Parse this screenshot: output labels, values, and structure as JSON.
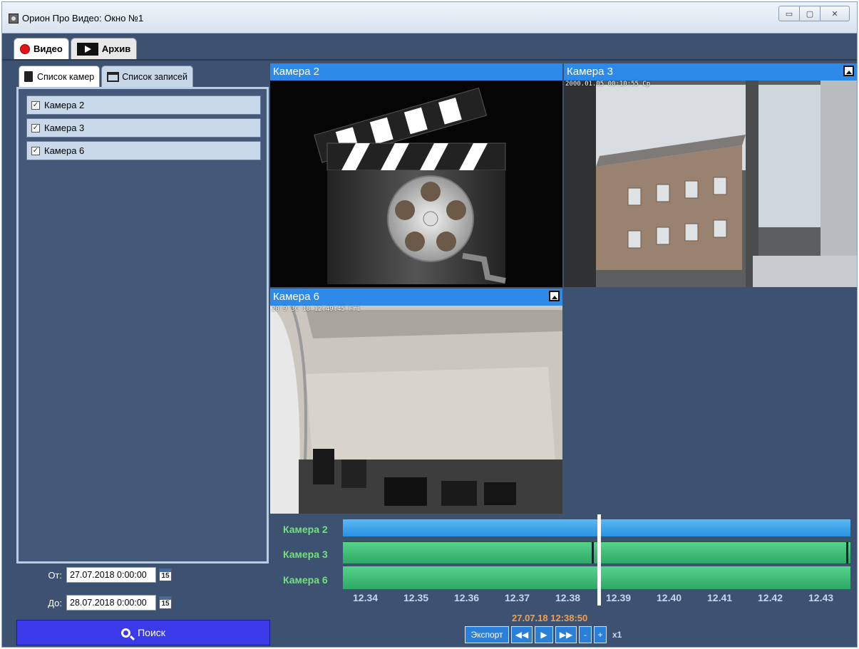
{
  "window": {
    "title": "Орион Про Видео: Окно №1",
    "minimize": "▭",
    "maximize": "▢",
    "close": "✕"
  },
  "top_tabs": [
    {
      "label": "Видео",
      "active": true
    },
    {
      "label": "Архив",
      "active": false
    }
  ],
  "left_tabs": [
    {
      "label": "Список камер",
      "active": true
    },
    {
      "label": "Список записей",
      "active": false
    }
  ],
  "camera_list": [
    {
      "label": "Камера 2",
      "checked": true
    },
    {
      "label": "Камера 3",
      "checked": true
    },
    {
      "label": "Камера 6",
      "checked": true
    }
  ],
  "date_from": {
    "label": "От:",
    "value": "27.07.2018 0:00:00"
  },
  "date_to": {
    "label": "До:",
    "value": "28.07.2018 0:00:00"
  },
  "calendar_day": "15",
  "search_label": "Поиск",
  "tiles": [
    {
      "title": "Камера 2",
      "osd": ""
    },
    {
      "title": "Камера 3",
      "osd": "2000.01.05 00:10:55 Ср"
    },
    {
      "title": "Камера 6",
      "osd": "20 9 3C 18 12:49:45 Fri"
    }
  ],
  "timeline": {
    "rows": [
      "Камера 2",
      "Камера 3",
      "Камера 6"
    ],
    "ticks": [
      "12.34",
      "12.35",
      "12.36",
      "12.37",
      "12.38",
      "12.39",
      "12.40",
      "12.41",
      "12.42",
      "12.43"
    ],
    "current_time": "27.07.18 12:38:50",
    "colors": {
      "camera2": "#3aa8f0",
      "camera3": "#3ec27a",
      "camera6": "#3ec27a"
    }
  },
  "controls": {
    "export": "Экспорт",
    "rewind": "◀◀",
    "play": "▶",
    "forward": "▶▶",
    "minus": "-",
    "plus": "+",
    "speed": "x1"
  }
}
